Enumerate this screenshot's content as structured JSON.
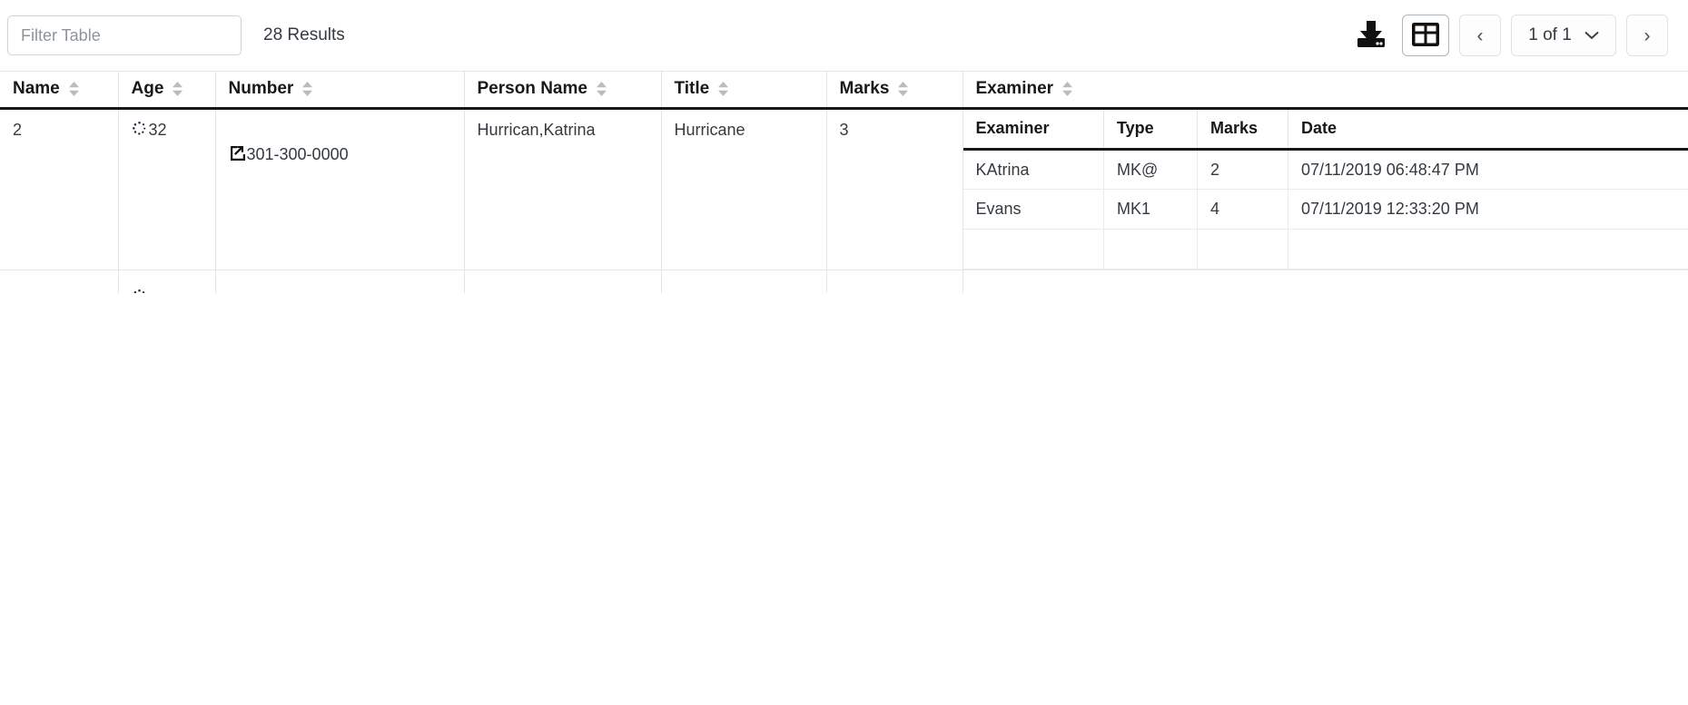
{
  "toolbar": {
    "filter_placeholder": "Filter Table",
    "filter_value": "",
    "results_label": "28 Results",
    "download_icon": "download-icon",
    "grid_view_icon": "table-grid-icon",
    "prev_label": "‹",
    "next_label": "›",
    "page_label": "1 of 1",
    "page_chevron_icon": "chevron-down-icon"
  },
  "table": {
    "columns": [
      {
        "label": "Name",
        "sortable": true
      },
      {
        "label": "Age",
        "sortable": true
      },
      {
        "label": "Number",
        "sortable": true
      },
      {
        "label": "Person Name",
        "sortable": true
      },
      {
        "label": "Title",
        "sortable": true
      },
      {
        "label": "Marks",
        "sortable": true
      },
      {
        "label": "Examiner",
        "sortable": true
      }
    ],
    "rows": [
      {
        "name": "2",
        "age": "32",
        "age_icon": "loading-spinner-icon",
        "number": "301-300-0000",
        "number_icon": "external-link-icon",
        "person_name": "Hurrican,Katrina",
        "title": "Hurricane",
        "marks": "3",
        "examiner_table": {
          "columns": [
            "Examiner",
            "Type",
            "Marks",
            "Date"
          ],
          "rows": [
            {
              "examiner": "KAtrina",
              "type": "MK@",
              "marks": "2",
              "date": "07/11/2019 06:48:47 PM"
            },
            {
              "examiner": "Evans",
              "type": "MK1",
              "marks": "4",
              "date": "07/11/2019 12:33:20 PM"
            }
          ]
        }
      },
      {
        "name": "",
        "age": "",
        "number": "",
        "person_name": "",
        "title": "",
        "marks": "",
        "examiner_table": {
          "columns": [],
          "rows": []
        }
      }
    ]
  },
  "scroll_top": {
    "icon": "arrow-up-icon",
    "color": "#fbce3b"
  },
  "colors": {
    "accent_yellow": "#fbce3b",
    "border": "#e3e6e8",
    "header_rule": "#16191c",
    "text": "#343a40"
  }
}
